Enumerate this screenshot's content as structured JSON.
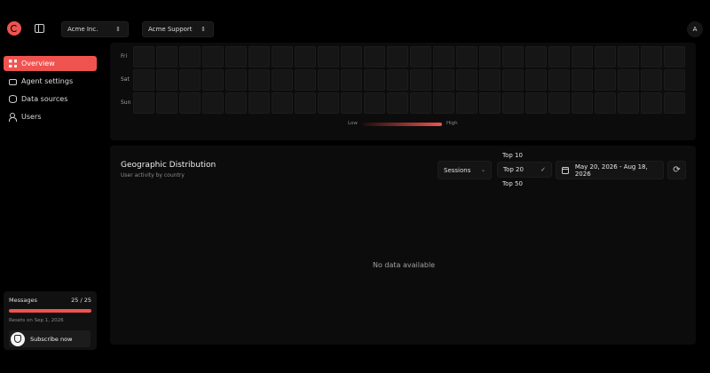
{
  "header": {
    "org_selector": "Acme Inc.",
    "project_selector": "Acme Support",
    "avatar_initial": "A"
  },
  "sidebar": {
    "items": [
      {
        "label": "Overview",
        "active": true,
        "icon": "grid-icon"
      },
      {
        "label": "Agent settings",
        "active": false,
        "icon": "bot-icon"
      },
      {
        "label": "Data sources",
        "active": false,
        "icon": "database-icon"
      },
      {
        "label": "Users",
        "active": false,
        "icon": "users-icon"
      }
    ],
    "usage": {
      "label": "Messages",
      "count": "25 / 25",
      "fill_fraction": 1.0,
      "reset_text": "Resets on Sep 1, 2026",
      "subscribe_label": "Subscribe now"
    }
  },
  "heatmap": {
    "days": [
      "Fri",
      "Sat",
      "Sun"
    ],
    "columns": 24,
    "legend_low": "Low",
    "legend_high": "High"
  },
  "geo": {
    "title": "Geographic Distribution",
    "subtitle": "User activity by country",
    "metric": "Sessions",
    "top_options": [
      "Top 10",
      "Top 20",
      "Top 50"
    ],
    "top_selected": "Top 20",
    "date_range": "May 20, 2026 - Aug 18, 2026",
    "empty_text": "No data available"
  },
  "colors": {
    "accent": "#ef5350",
    "background": "#000000",
    "card": "#0c0c0c"
  }
}
